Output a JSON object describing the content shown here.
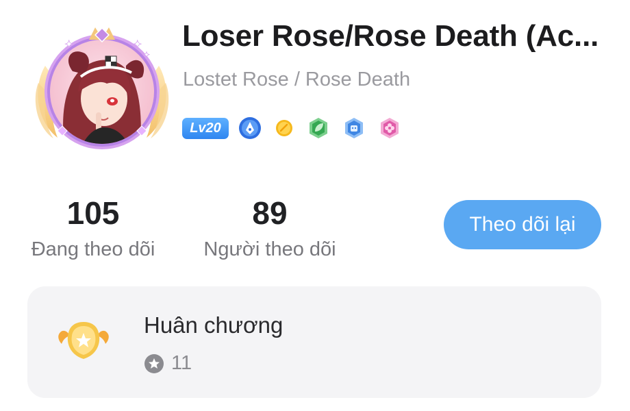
{
  "profile": {
    "display_name": "Loser Rose/Rose Death (Ac...",
    "username": "Lostet Rose / Rose Death",
    "level": "Lv20",
    "badges": [
      "blue-pen-badge",
      "gold-coin-badge",
      "green-leaf-badge",
      "blue-robot-badge",
      "pink-flower-badge"
    ],
    "avatar": "anime-girl-avatar-with-winged-frame"
  },
  "stats": {
    "following_count": "105",
    "following_label": "Đang theo dõi",
    "followers_count": "89",
    "followers_label": "Người theo dõi"
  },
  "actions": {
    "follow_back_label": "Theo dõi lại"
  },
  "medals": {
    "title": "Huân chương",
    "count": "11"
  },
  "colors": {
    "accent_blue": "#5aa8f2",
    "card_bg": "#f4f4f6",
    "frame_purple": "#c58ae8"
  }
}
